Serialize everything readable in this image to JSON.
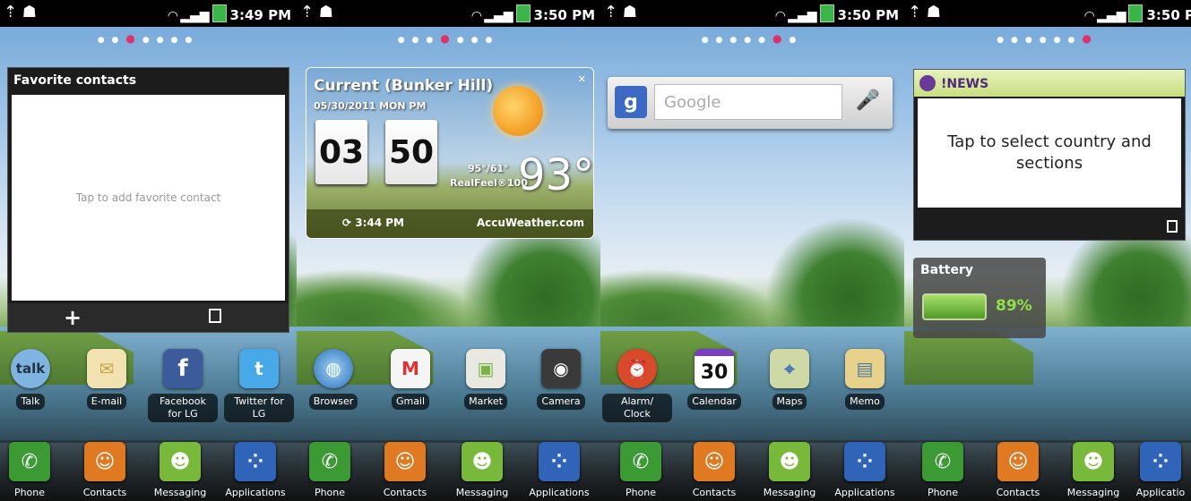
{
  "dock": {
    "phone": "Phone",
    "contacts": "Contacts",
    "messaging": "Messaging",
    "applications": "Applications",
    "applications_truncated": "Applicatio"
  },
  "screen1": {
    "time": "3:49 PM",
    "widget_title": "Favorite contacts",
    "widget_hint": "Tap to add favorite contact",
    "apps": [
      {
        "label": "Talk",
        "icon": "talk-icon"
      },
      {
        "label": "E-mail",
        "icon": "email-icon"
      },
      {
        "label": "Facebook for LG",
        "icon": "facebook-icon"
      },
      {
        "label": "Twitter for LG",
        "icon": "twitter-icon"
      }
    ]
  },
  "screen2": {
    "time": "3:50 PM",
    "weather_title": "Current (Bunker Hill)",
    "weather_date": "05/30/2011 MON PM",
    "clock_hour": "03",
    "clock_min": "50",
    "hi_lo": "95°/61°",
    "realfeel": "RealFeel®100",
    "temperature": "93°",
    "updated": "3:44 PM",
    "brand": "AccuWeather.com",
    "apps": [
      {
        "label": "Browser",
        "icon": "browser-icon"
      },
      {
        "label": "Gmail",
        "icon": "gmail-icon"
      },
      {
        "label": "Market",
        "icon": "market-icon"
      },
      {
        "label": "Camera",
        "icon": "camera-icon"
      }
    ]
  },
  "screen3": {
    "time": "3:50 PM",
    "search_placeholder": "Google",
    "calendar_day": "30",
    "apps": [
      {
        "label": "Alarm/ Clock",
        "icon": "alarm-clock-icon"
      },
      {
        "label": "Calendar",
        "icon": "calendar-icon"
      },
      {
        "label": "Maps",
        "icon": "maps-icon"
      },
      {
        "label": "Memo",
        "icon": "memo-icon"
      }
    ]
  },
  "screen4": {
    "time": "3:50 P",
    "news_title": "!NEWS",
    "news_body": "Tap to select country and sections",
    "battery_title": "Battery",
    "battery_percent": "89%"
  },
  "colors": {
    "active_dot": "#e0306a",
    "phone_green": "#3c9a35",
    "contacts_orange": "#e07a22",
    "messaging_green": "#78b83a",
    "applications_blue": "#2f64b8"
  }
}
